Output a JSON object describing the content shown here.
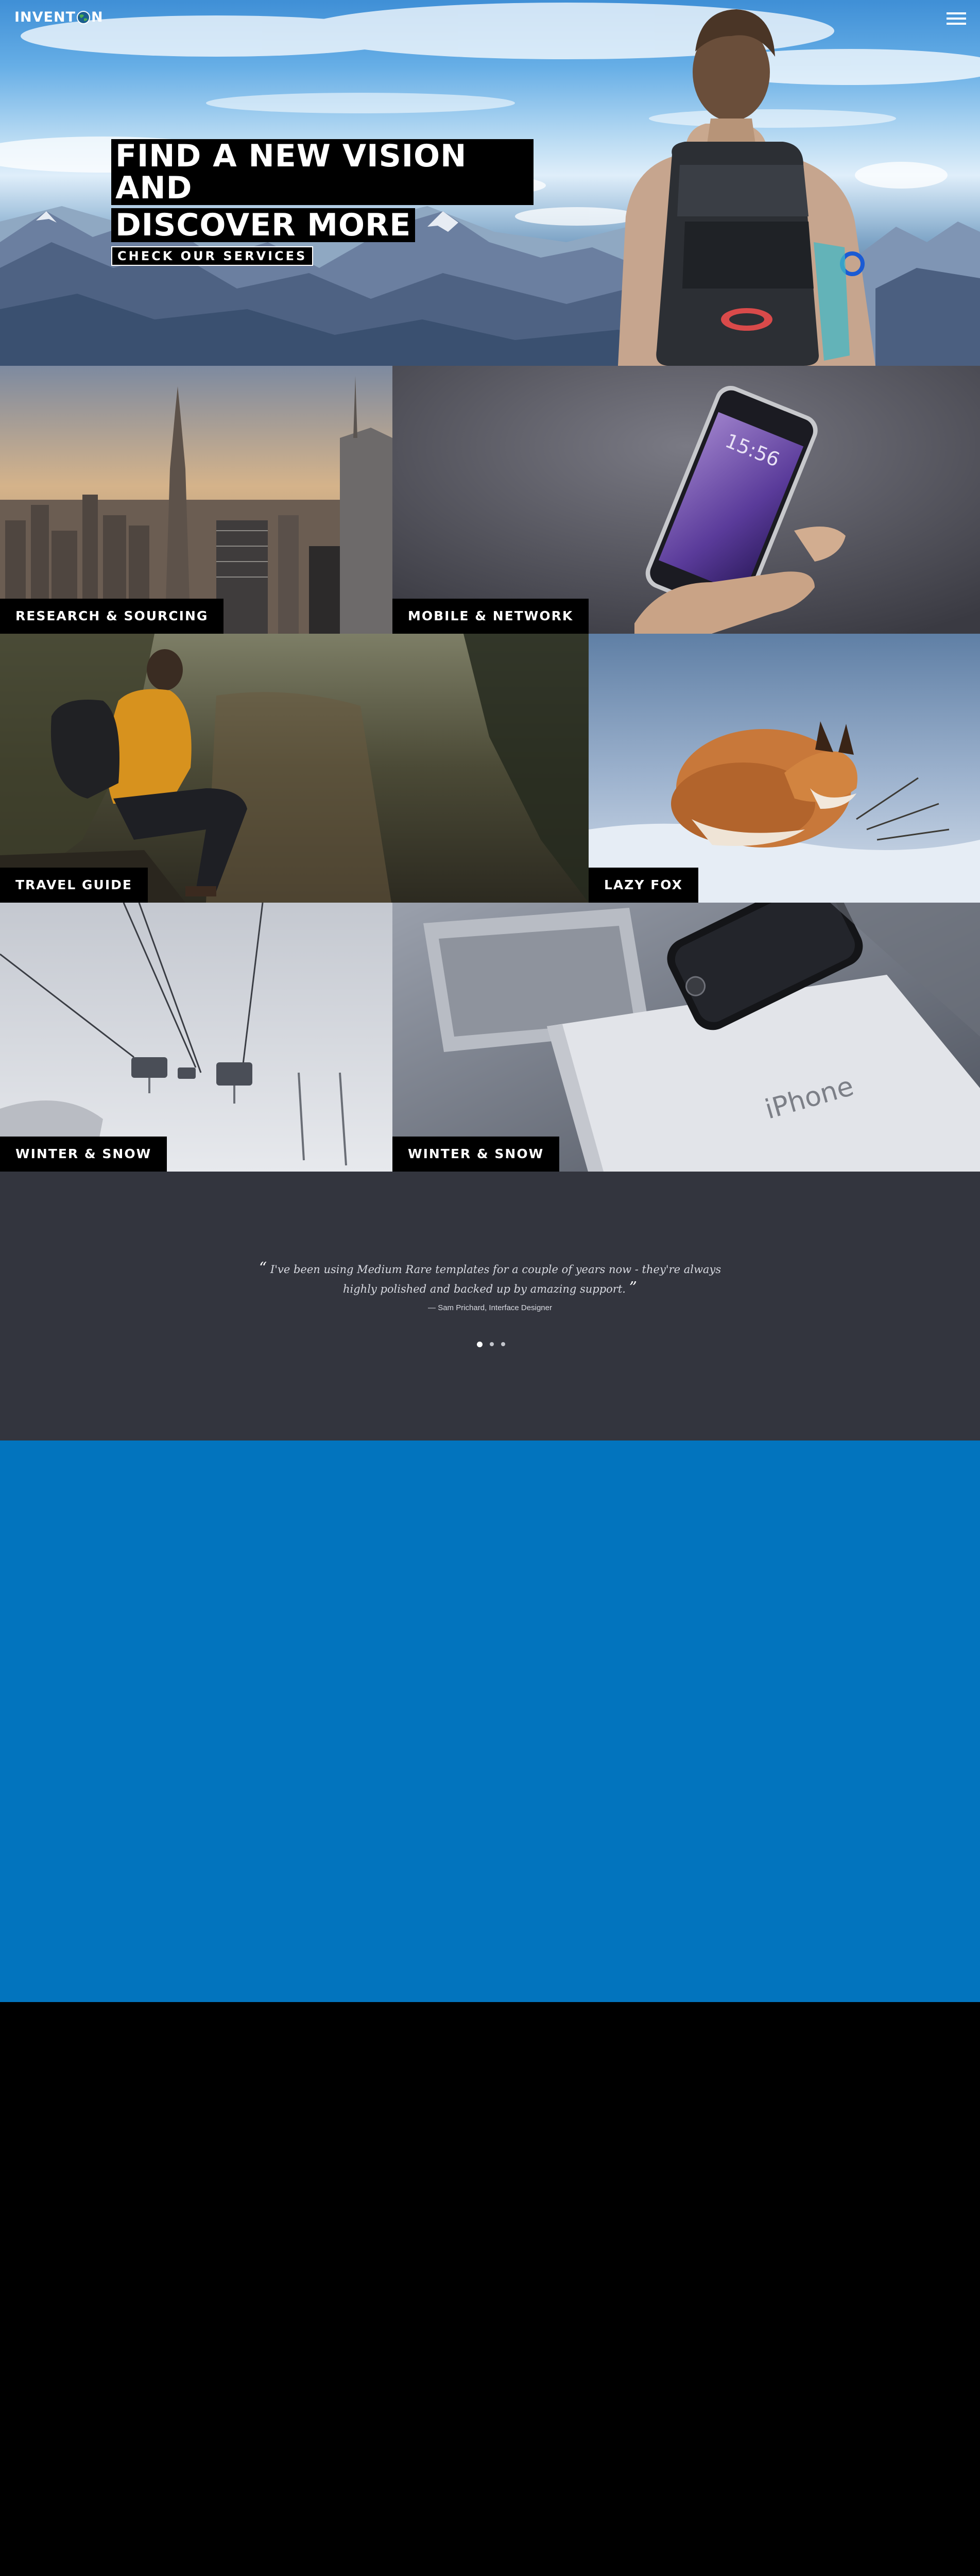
{
  "brand": {
    "logo_pre": "INVENT",
    "logo_post": "N"
  },
  "hero": {
    "headline_line1": "FIND A NEW VISION AND",
    "headline_line2": "DISCOVER MORE",
    "cta_label": "CHECK OUR SERVICES"
  },
  "tiles": [
    {
      "caption": "RESEARCH & SOURCING"
    },
    {
      "caption": "MOBILE & NETWORK"
    },
    {
      "caption": "TRAVEL GUIDE"
    },
    {
      "caption": "LAZY FOX"
    },
    {
      "caption": "WINTER & SNOW"
    },
    {
      "caption": "WINTER & SNOW"
    }
  ],
  "phone_screen": {
    "time": "15:56"
  },
  "iphone_box": {
    "label": "iPhone"
  },
  "testimonial": {
    "quote": "I've been using Medium Rare templates for a couple of years now - they're always highly polished and backed up by amazing support.",
    "author": "— Sam Prichard, Interface Designer",
    "slide_count": 3,
    "active_slide": 1
  },
  "colors": {
    "testimonial_bg": "#33353e",
    "blue_band": "#0274be",
    "caption_bg": "#000000"
  },
  "icons": {
    "menu": "hamburger-menu-icon",
    "logo_glyph": "globe-icon"
  }
}
